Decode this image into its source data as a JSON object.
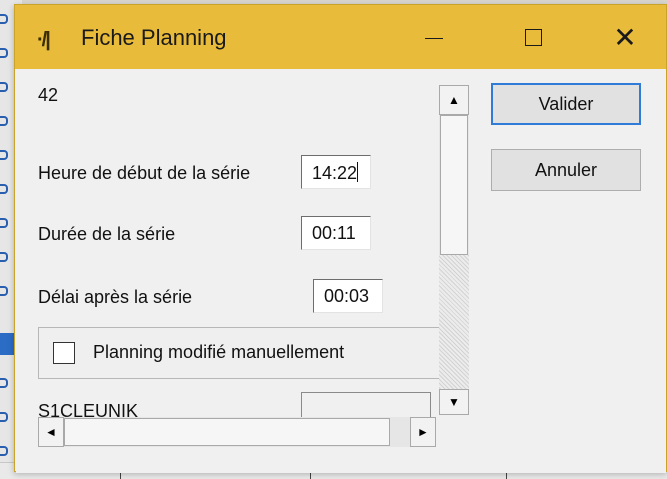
{
  "window": {
    "title": "Fiche Planning",
    "icon": "app-icon",
    "title_bar_color": "#e9bb3a",
    "controls": {
      "minimize": "minimize-icon",
      "maximize": "maximize-icon",
      "close": "close-icon"
    }
  },
  "form": {
    "record_number": "42",
    "start_time": {
      "label": "Heure de début de la série",
      "value": "14:22"
    },
    "duration": {
      "label": "Durée de la série",
      "value": "00:11"
    },
    "delay_after": {
      "label": "Délai après la série",
      "value": "00:03"
    },
    "manual_checkbox": {
      "label": "Planning modifié manuellement",
      "checked": false
    },
    "next_field": {
      "label": "S1CLEUNIK",
      "value": ""
    }
  },
  "buttons": {
    "validate": "Valider",
    "cancel": "Annuler"
  },
  "scrollbars": {
    "up_arrow": "▲",
    "down_arrow": "▼",
    "left_arrow": "◄",
    "right_arrow": "►"
  },
  "colors": {
    "accent_focus": "#2f7bd6"
  }
}
